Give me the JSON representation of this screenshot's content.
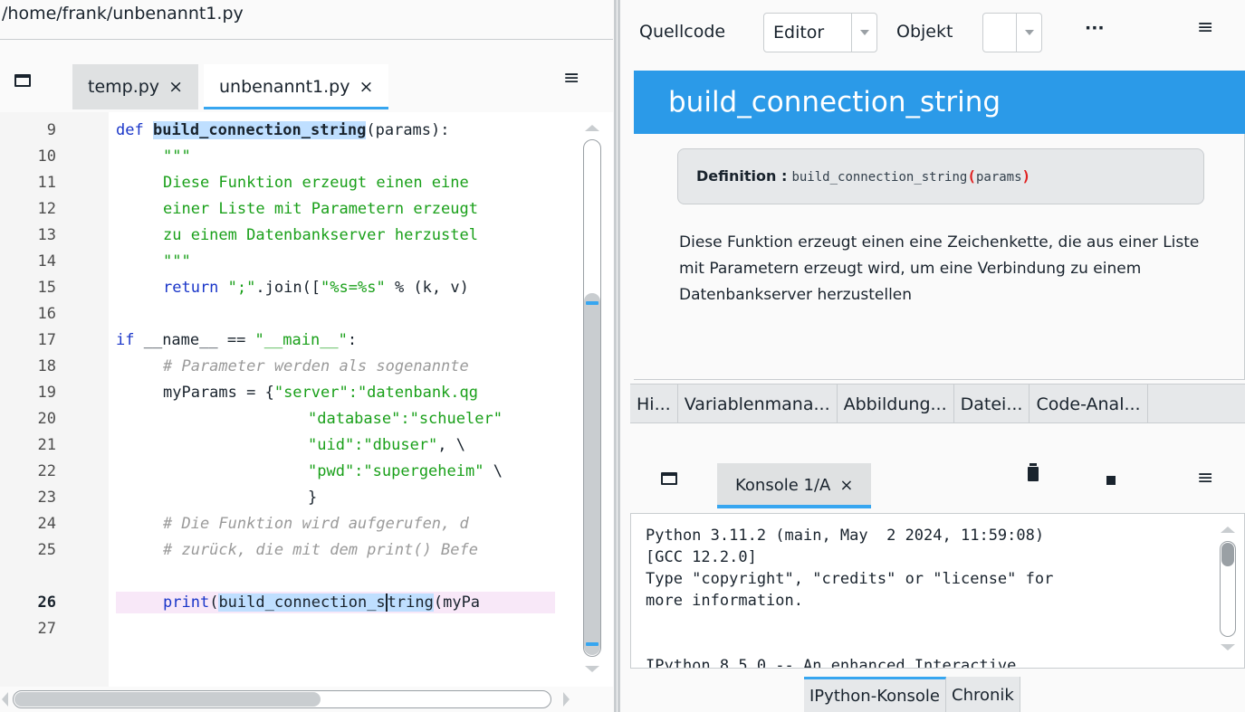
{
  "editor": {
    "path": "/home/frank/unbenannt1.py",
    "tabs": [
      {
        "label": "temp.py",
        "close": "×"
      },
      {
        "label": "unbenannt1.py",
        "close": "×"
      }
    ],
    "menu_icon": "hamburger-menu-icon",
    "line_numbers": [
      "9",
      "10",
      "11",
      "12",
      "13",
      "14",
      "15",
      "16",
      "17",
      "18",
      "19",
      "20",
      "21",
      "22",
      "23",
      "24",
      "25",
      "26",
      "27"
    ],
    "current_line": "26",
    "lines": {
      "l9": {
        "kw": "def",
        "fn": "build_connection_string",
        "rest": "(params):"
      },
      "l10": "\"\"\"",
      "l11": "Diese Funktion erzeugt einen eine",
      "l12": "einer Liste mit Parametern erzeugt",
      "l13": "zu einem Datenbankserver herzustel",
      "l14": "\"\"\"",
      "l15": {
        "kw": "return",
        "s1": "\";\"",
        "mid": ".join([",
        "s2": "\"%s=%s\"",
        "rest": " % (k, v)"
      },
      "l17": {
        "kw": "if",
        "mid": " __name__ == ",
        "s": "\"__main__\"",
        "rest": ":"
      },
      "l18": "# Parameter werden als sogenannte",
      "l19": {
        "pre": "myParams = {",
        "s": "\"server\":\"datenbank.qg"
      },
      "l20": "\"database\":\"schueler\"",
      "l21": {
        "s": "\"uid\":\"dbuser\"",
        "rest": ", \\"
      },
      "l22": {
        "s": "\"pwd\":\"supergeheim\"",
        "rest": " \\"
      },
      "l23": "}",
      "l24": "# Die Funktion wird aufgerufen, d",
      "l25": "# zurück, die mit dem print() Befe",
      "l26": {
        "kw": "print",
        "pre": "(",
        "h1": "build_connection_s",
        "h2": "tring",
        "rest": "(myPa"
      }
    }
  },
  "help": {
    "toolbar": {
      "source_label": "Quellcode",
      "source_value": "Editor",
      "object_label": "Objekt",
      "object_value": "",
      "more": "···"
    },
    "title": "build_connection_string",
    "definition_label": "Definition :",
    "definition_name": "build_connection_string",
    "definition_open": "(",
    "definition_params": "params",
    "definition_close": ")",
    "docstring": "Diese Funktion erzeugt einen eine Zeichenkette, die aus einer Liste mit Parametern erzeugt wird, um eine Verbindung zu einem Datenbankserver herzustellen"
  },
  "dock_tabs": [
    "Hi...",
    "Variablenmana...",
    "Abbildung...",
    "Datei...",
    "Code-Anal..."
  ],
  "console": {
    "tab_label": "Konsole 1/A",
    "tab_close": "×",
    "lines": [
      "Python 3.11.2 (main, May  2 2024, 11:59:08)",
      "[GCC 12.2.0]",
      "Type \"copyright\", \"credits\" or \"license\" for",
      "more information.",
      "",
      "IPython 8.5.0 -- An enhanced Interactive"
    ]
  },
  "bottom_tabs": [
    "IPython-Konsole",
    "Chronik"
  ],
  "colors": {
    "accent": "#37a6f0",
    "title_bar": "#2b9ae8",
    "keyword": "#1a36c9",
    "string": "#1aa01a",
    "comment": "#9a9a9a"
  }
}
